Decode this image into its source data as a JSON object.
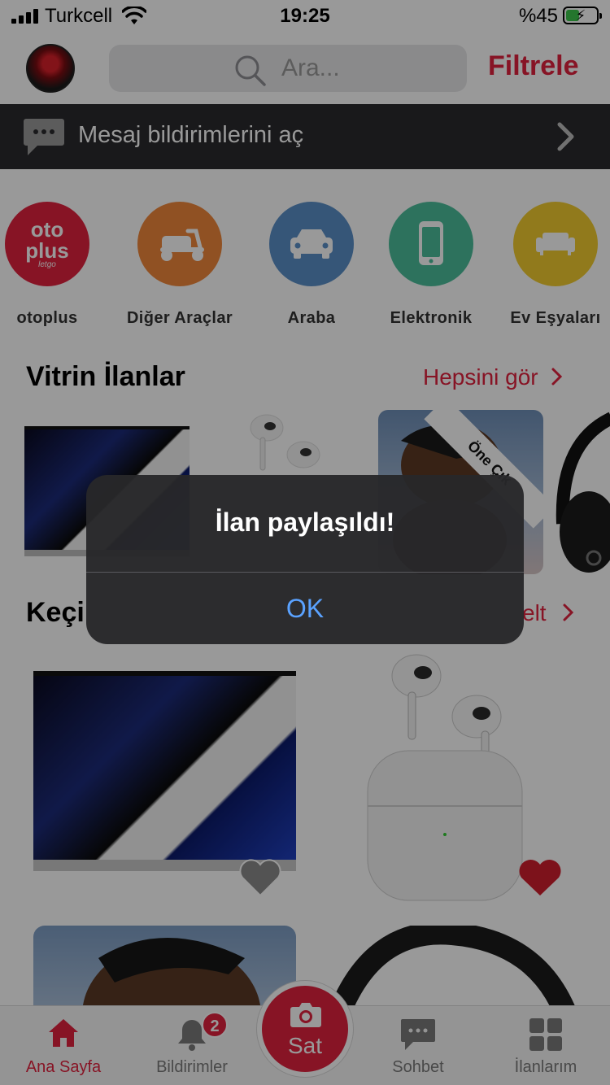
{
  "status_bar": {
    "carrier": "Turkcell",
    "time": "19:25",
    "battery": "%45",
    "battery_level": 0.45
  },
  "header": {
    "search_placeholder": "Ara...",
    "filter_label": "Filtrele"
  },
  "notification_banner": {
    "label": "Mesaj bildirimlerini aç"
  },
  "categories": [
    {
      "name": "otoplus",
      "logo_text": "oto",
      "logo_text2": "plus",
      "logo_sub": "letgo",
      "color": "#e2223f"
    },
    {
      "name": "Diğer Araçlar",
      "icon": "scooter-icon",
      "color": "#f0873b"
    },
    {
      "name": "Araba",
      "icon": "car-icon",
      "color": "#5b8fc9"
    },
    {
      "name": "Elektronik",
      "icon": "phone-icon",
      "color": "#4bbf9b"
    },
    {
      "name": "Ev Eşyaları",
      "icon": "sofa-icon",
      "color": "#f2cc2f"
    }
  ],
  "vitrin": {
    "title": "Vitrin İlanlar",
    "link": "Hepsini gör",
    "ribbon": "Öne Çık"
  },
  "kesfet": {
    "title_visible": "Keçi",
    "link_visible": "elt"
  },
  "tabbar": {
    "tabs": [
      {
        "label": "Ana Sayfa",
        "icon": "home-icon",
        "active": true
      },
      {
        "label": "Bildirimler",
        "icon": "bell-icon",
        "badge": "2"
      },
      {
        "label": "Sohbet",
        "icon": "chat-icon"
      },
      {
        "label": "İlanlarım",
        "icon": "grid-icon"
      }
    ],
    "sell_label": "Sat"
  },
  "alert": {
    "message": "İlan paylaşıldı!",
    "ok_label": "OK"
  },
  "colors": {
    "brand": "#e2223f",
    "alert_button": "#5aa2ff"
  }
}
